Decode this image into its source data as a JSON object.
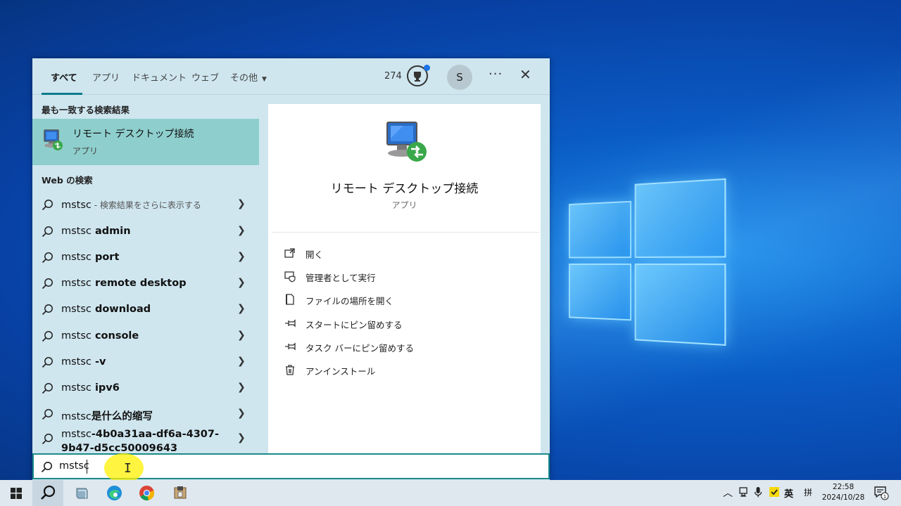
{
  "start_menu": {
    "tabs": [
      {
        "label": "すべて",
        "active": true
      },
      {
        "label": "アプリ"
      },
      {
        "label": "ドキュメント"
      },
      {
        "label": "ウェブ"
      },
      {
        "label": "その他"
      }
    ],
    "points": "274",
    "avatar_initial": "S",
    "more_label": "···",
    "close_label": "✕",
    "best_match": {
      "section_title": "最も一致する検索結果",
      "name": "リモート デスクトップ接続",
      "type": "アプリ"
    },
    "web_search": {
      "section_title": "Web の検索",
      "items": [
        {
          "prefix": "mstsc",
          "rest": "",
          "hint": " - 検索結果をさらに表示する"
        },
        {
          "prefix": "mstsc",
          "rest": " admin",
          "hint": ""
        },
        {
          "prefix": "mstsc",
          "rest": " port",
          "hint": ""
        },
        {
          "prefix": "mstsc",
          "rest": " remote desktop",
          "hint": ""
        },
        {
          "prefix": "mstsc",
          "rest": " download",
          "hint": ""
        },
        {
          "prefix": "mstsc",
          "rest": " console",
          "hint": ""
        },
        {
          "prefix": "mstsc",
          "rest": " -v",
          "hint": ""
        },
        {
          "prefix": "mstsc",
          "rest": " ipv6",
          "hint": ""
        },
        {
          "prefix": "mstsc",
          "rest": "是什么的缩写",
          "hint": ""
        },
        {
          "prefix": "mstsc",
          "rest": "-4b0a31aa-df6a-4307-9b47-d5cc50009643",
          "hint": ""
        }
      ]
    },
    "detail": {
      "name": "リモート デスクトップ接続",
      "type": "アプリ",
      "actions": [
        {
          "icon": "open-icon",
          "label": "開く"
        },
        {
          "icon": "shield-icon",
          "label": "管理者として実行"
        },
        {
          "icon": "file-location-icon",
          "label": "ファイルの場所を開く"
        },
        {
          "icon": "pin-icon",
          "label": "スタートにピン留めする"
        },
        {
          "icon": "pin-icon",
          "label": "タスク バーにピン留めする"
        },
        {
          "icon": "trash-icon",
          "label": "アンインストール"
        }
      ]
    }
  },
  "search": {
    "query": "mstsc"
  },
  "taskbar": {
    "ime_mode": "英",
    "ime_alt": "拼",
    "clock_time": "22:58",
    "clock_date": "2024/10/28",
    "notification_count": "1"
  },
  "colors": {
    "menu_bg": "#cfe6ef",
    "highlight": "#8ecfcd",
    "accent": "#0f7b8a"
  }
}
